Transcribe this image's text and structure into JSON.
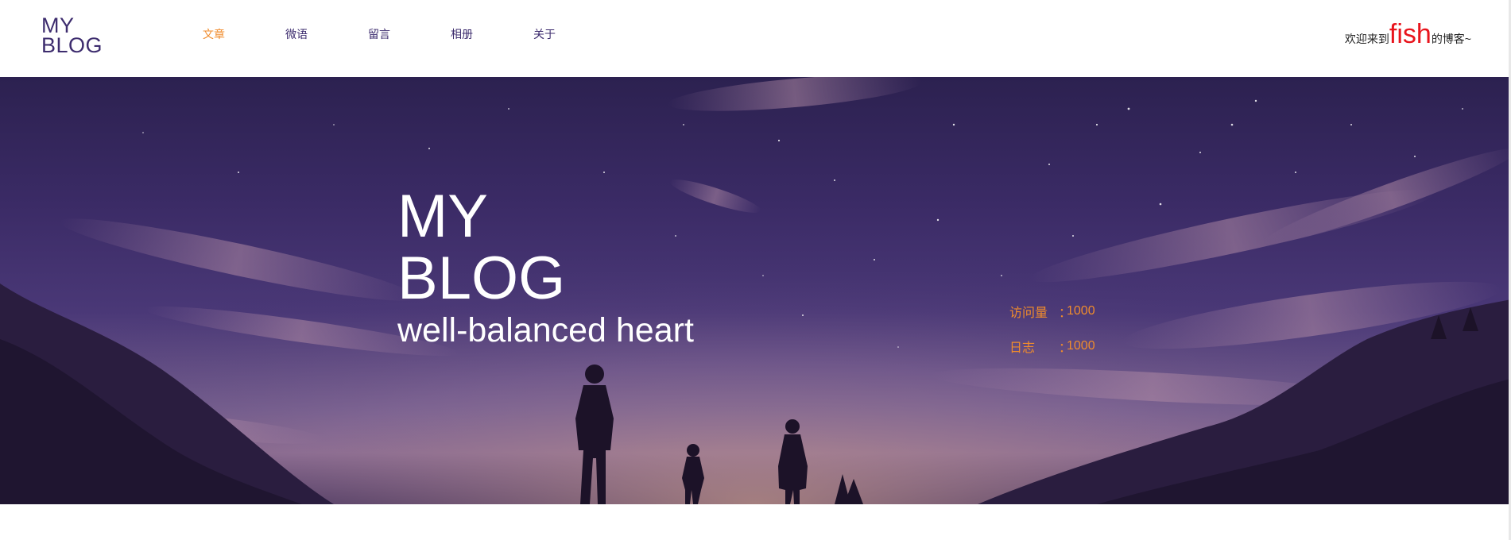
{
  "logo": {
    "line1": "MY",
    "line2": "BLOG"
  },
  "nav": {
    "items": [
      {
        "label": "文章",
        "active": true
      },
      {
        "label": "微语",
        "active": false
      },
      {
        "label": "留言",
        "active": false
      },
      {
        "label": "相册",
        "active": false
      },
      {
        "label": "关于",
        "active": false
      }
    ]
  },
  "welcome": {
    "prefix": "欢迎来到",
    "name": "fish",
    "suffix": "的博客~"
  },
  "hero": {
    "title_line1": "MY",
    "title_line2": "BLOG",
    "subtitle": "well-balanced heart"
  },
  "stats": [
    {
      "label": "访问量",
      "separator": "：",
      "value": "1000"
    },
    {
      "label": "日志",
      "separator": "：",
      "value": "1000"
    }
  ],
  "colors": {
    "accent": "#f08c2c",
    "brand": "#3d2c6e",
    "highlight": "#e8141c"
  }
}
